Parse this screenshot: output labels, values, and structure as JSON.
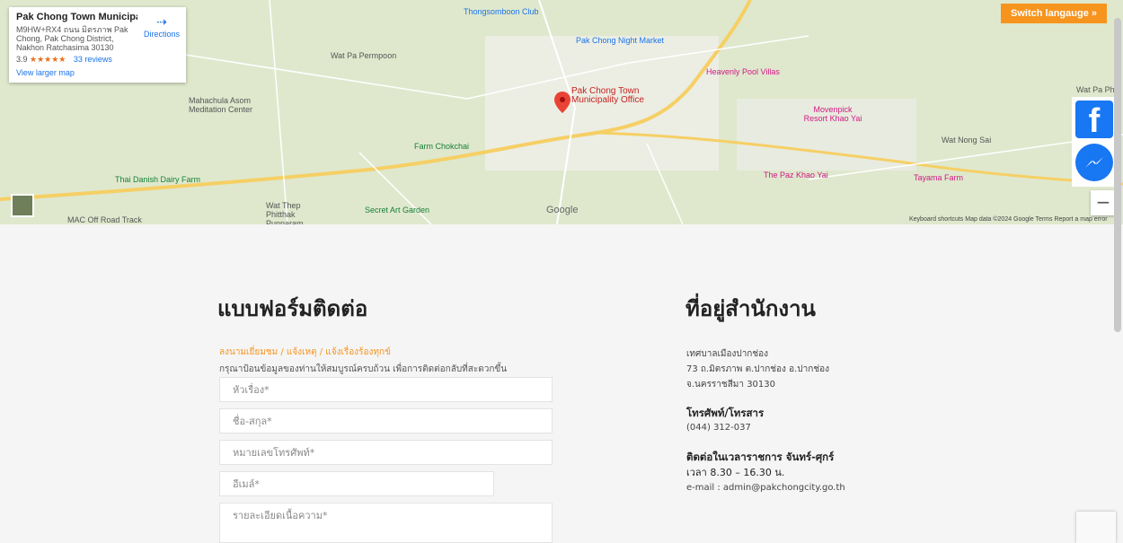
{
  "map": {
    "card": {
      "title": "Pak Chong Town Municipality ...",
      "address": "M9HW+RX4 ถนน มิตรภาพ Pak Chong, Pak Chong District, Nakhon Ratchasima 30130",
      "rating": "3.9",
      "stars": "★★★★★",
      "reviews": "33 reviews",
      "directions": "Directions",
      "view_larger": "View larger map"
    },
    "pin_label": "Pak Chong Town\nMunicipality Office",
    "labels": {
      "night_market": "Pak Chong Night Market",
      "thongsomboon": "Thongsomboon Club",
      "wat_pa_permpoon": "Wat Pa Permpoon",
      "heavenly": "Heavenly Pool Villas",
      "movenpick": "Movenpick Resort Khao Yai",
      "farm_chokchai": "Farm Chokchai",
      "thai_danish": "Thai Danish Dairy Farm",
      "secret_art": "Secret Art Garden",
      "wat_thep": "Wat Thep Phitthak Punnaram",
      "paz": "The Paz Khao Yai",
      "tayama": "Tayama Farm",
      "mahachula": "Mahachula Asom Meditation Center",
      "wat_nong_sai": "Wat Nong Sai",
      "wat_pa_phu": "Wat Pa Phu",
      "mac": "MAC Off Road Track"
    },
    "attribution": "Keyboard shortcuts   Map data ©2024 Google   Terms   Report a map error",
    "google": "Google",
    "zoom_out": "−"
  },
  "switch_language": "Switch langauge »",
  "form": {
    "title": "แบบฟอร์มติดต่อ",
    "subtitle": "ลงนามเยี่ยมชม / แจ้งเหตุ / แจ้งเรื่องร้องทุกข์",
    "hint": "กรุณาป้อนข้อมูลของท่านให้สมบูรณ์ครบถ้วน เพื่อการติดต่อกลับที่สะดวกขึ้น",
    "subject": "หัวเรื่อง*",
    "name": "ชื่อ-สกุล*",
    "phone": "หมายเลขโทรศัพท์*",
    "email": "อีเมล์*",
    "details": "รายละเอียดเนื้อความ*"
  },
  "address": {
    "title": "ที่อยู่สำนักงาน",
    "line1": "เทศบาลเมืองปากช่อง",
    "line2": "73 ถ.มิตรภาพ ต.ปากช่อง อ.ปากช่อง",
    "line3": "จ.นครราชสีมา 30130",
    "phone_heading": "โทรศัพท์/โทรสาร",
    "phone": "(044) 312-037",
    "hours_heading": "ติดต่อในเวลาราชการ จันทร์-ศุกร์",
    "hours": "เวลา 8.30 – 16.30 น.",
    "email": "e-mail : admin@pakchongcity.go.th"
  },
  "colors": {
    "accent": "#f7941d",
    "facebook": "#1877f2",
    "pin": "#ea4335"
  }
}
